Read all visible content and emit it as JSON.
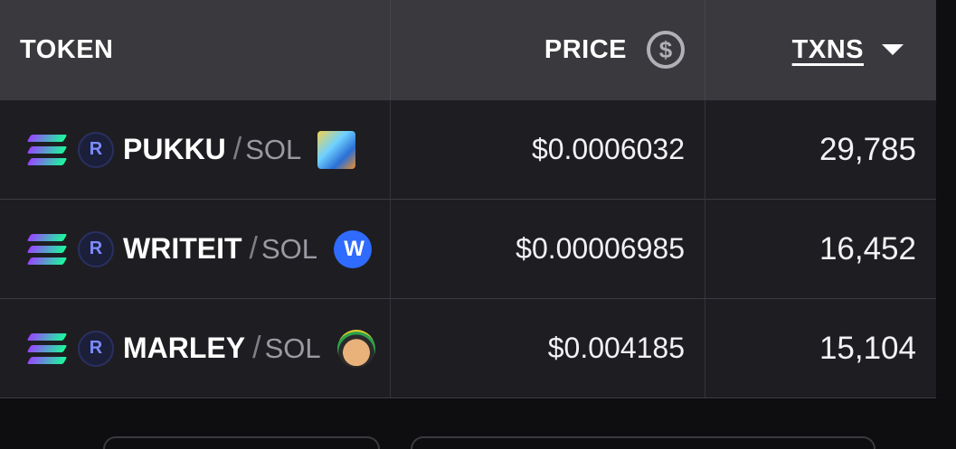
{
  "header": {
    "token_label": "TOKEN",
    "price_label": "PRICE",
    "price_icon": "$",
    "txns_label": "TXNS"
  },
  "rows": [
    {
      "chain": "solana-icon",
      "dex": "raydium-icon",
      "symbol": "PUKKU",
      "separator": "/",
      "quote": "SOL",
      "logo": "pukku-logo",
      "price": "$0.0006032",
      "txns": "29,785"
    },
    {
      "chain": "solana-icon",
      "dex": "raydium-icon",
      "symbol": "WRITEIT",
      "separator": "/",
      "quote": "SOL",
      "logo": "writeit-logo",
      "logo_text": "W",
      "price": "$0.00006985",
      "txns": "16,452"
    },
    {
      "chain": "solana-icon",
      "dex": "raydium-icon",
      "symbol": "MARLEY",
      "separator": "/",
      "quote": "SOL",
      "logo": "marley-logo",
      "price": "$0.004185",
      "txns": "15,104"
    }
  ],
  "colors": {
    "header_bg": "#39393e",
    "row_bg": "#1e1e22",
    "page_bg": "#111113",
    "writeit_logo": "#2f6bff"
  }
}
